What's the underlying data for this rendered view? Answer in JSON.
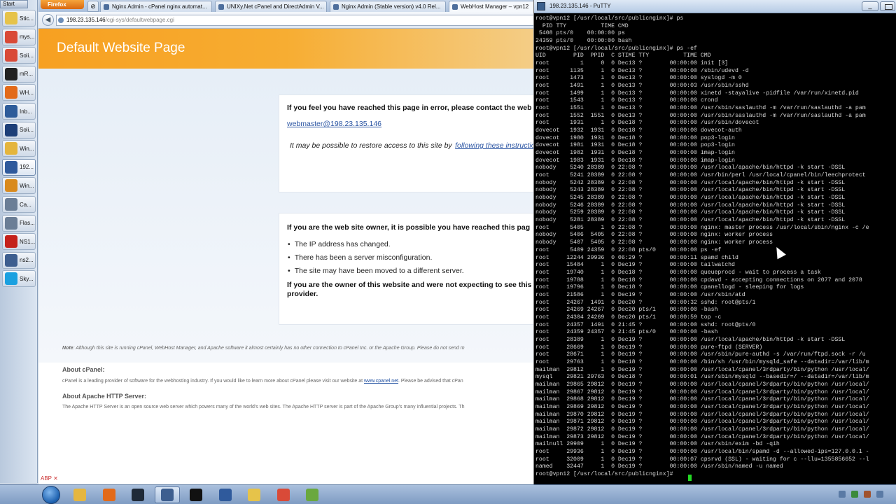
{
  "launcher": {
    "start_label": "Start",
    "items": [
      {
        "label": "Stic...",
        "icon": "sticky-notes-icon",
        "color": "#e6c34a"
      },
      {
        "label": "mys...",
        "icon": "chrome-icon",
        "color": "#d94a38"
      },
      {
        "label": "Soli...",
        "icon": "chrome-icon",
        "color": "#d94a38"
      },
      {
        "label": "mR...",
        "icon": "remote-icon",
        "color": "#222222"
      },
      {
        "label": "WH...",
        "icon": "firefox-icon",
        "color": "#e26a1a"
      },
      {
        "label": "Inb...",
        "icon": "thunderbird-icon",
        "color": "#2e5c9a"
      },
      {
        "label": "Soli...",
        "icon": "accessibility-icon",
        "color": "#1d3f78"
      },
      {
        "label": "Win...",
        "icon": "folder-icon",
        "color": "#e4b53d"
      },
      {
        "label": "192...",
        "icon": "network-icon",
        "color": "#2f5a9c"
      },
      {
        "label": "Win...",
        "icon": "media-icon",
        "color": "#d98a1d"
      },
      {
        "label": "Ca...",
        "icon": "window-icon",
        "color": "#6b7e96"
      },
      {
        "label": "Flas...",
        "icon": "window-icon",
        "color": "#6b7e96"
      },
      {
        "label": "NS1...",
        "icon": "filezilla-icon",
        "color": "#c4211b"
      },
      {
        "label": "ns2...",
        "icon": "putty-icon",
        "color": "#3d5e8f"
      },
      {
        "label": "Sky...",
        "icon": "skype-icon",
        "color": "#1aa0e0"
      }
    ]
  },
  "browser": {
    "menu_label": "Firefox",
    "tabs": [
      {
        "label": "Nginx Admin - cPanel nginx automat..."
      },
      {
        "label": "UNIXy.Net cPanel and DirectAdmin V..."
      },
      {
        "label": "Nginx Admin (Stable version) v4.0 Rel..."
      },
      {
        "label": "WebHost Manager – vpn12"
      }
    ],
    "url_host": "198.23.135.146",
    "url_path": "/cgi-sys/defaultwebpage.cgi",
    "page": {
      "title": "Default Website Page",
      "error_heading": "If you feel you have reached this page in error, please contact the web",
      "webmaster_email": "webmaster@198.23.135.146",
      "restore_text": "It may be possible to restore access to this site by",
      "restore_link": "following these instructio",
      "owner_heading": "If you are the web site owner, it is possible you have reached this pag",
      "reasons": [
        "The IP address has changed.",
        "There has been a server misconfiguration.",
        "The site may have been moved to a different server."
      ],
      "owner_not_expecting": "If you are the owner of this website and were not expecting to see this",
      "provider": "provider.",
      "note_label": "Note",
      "note_text": ": Although this site is running cPanel, WebHost Manager, and Apache software it almost certainly has no other connection to cPanel Inc. or the Apache Group. Please do not send m",
      "about_cpanel_heading": "About cPanel:",
      "about_cpanel_text": "cPanel is a leading provider of software for the webhosting industry. If you would like to learn more about cPanel please visit our website at",
      "about_cpanel_link": "www.cpanel.net",
      "about_cpanel_tail": ". Please be advised that cPan",
      "about_apache_heading": "About Apache HTTP Server:",
      "about_apache_text": "The Apache HTTP Server is an open source web server which powers many of the world's web sites. The Apache HTTP server is part of the Apache Group's many influential projects. Th"
    }
  },
  "putty": {
    "title": "198.23.135.146 - PuTTY",
    "lines": [
      "root@vpn12 [/usr/local/src/publicnginx]# ps",
      "  PID TTY          TIME CMD",
      " 5408 pts/0    00:00:00 ps",
      "24359 pts/0    00:00:00 bash",
      "root@vpn12 [/usr/local/src/publicnginx]# ps -ef",
      "UID        PID  PPID  C STIME TTY          TIME CMD",
      "root         1     0  0 Dec13 ?        00:00:00 init [3]",
      "root      1135     1  0 Dec13 ?        00:00:00 /sbin/udevd -d",
      "root      1473     1  0 Dec13 ?        00:00:00 syslogd -m 0",
      "root      1491     1  0 Dec13 ?        00:00:03 /usr/sbin/sshd",
      "root      1499     1  0 Dec13 ?        00:00:00 xinetd -stayalive -pidfile /var/run/xinetd.pid",
      "root      1543     1  0 Dec13 ?        00:00:00 crond",
      "root      1551     1  0 Dec13 ?        00:00:00 /usr/sbin/saslauthd -m /var/run/saslauthd -a pam",
      "root      1552  1551  0 Dec13 ?        00:00:00 /usr/sbin/saslauthd -m /var/run/saslauthd -a pam",
      "root      1931     1  0 Dec18 ?        00:00:00 /usr/sbin/dovecot",
      "dovecot   1932  1931  0 Dec18 ?        00:00:00 dovecot-auth",
      "dovecot   1980  1931  0 Dec18 ?        00:00:00 pop3-login",
      "dovecot   1981  1931  0 Dec18 ?        00:00:00 pop3-login",
      "dovecot   1982  1931  0 Dec18 ?        00:00:00 imap-login",
      "dovecot   1983  1931  0 Dec18 ?        00:00:00 imap-login",
      "nobody    5240 28389  0 22:08 ?        00:00:00 /usr/local/apache/bin/httpd -k start -DSSL",
      "root      5241 28389  0 22:08 ?        00:00:00 /usr/bin/perl /usr/local/cpanel/bin/leechprotect",
      "nobody    5242 28389  0 22:08 ?        00:00:00 /usr/local/apache/bin/httpd -k start -DSSL",
      "nobody    5243 28389  0 22:08 ?        00:00:00 /usr/local/apache/bin/httpd -k start -DSSL",
      "nobody    5245 28389  0 22:08 ?        00:00:00 /usr/local/apache/bin/httpd -k start -DSSL",
      "nobody    5246 28389  0 22:08 ?        00:00:00 /usr/local/apache/bin/httpd -k start -DSSL",
      "nobody    5259 28389  0 22:08 ?        00:00:00 /usr/local/apache/bin/httpd -k start -DSSL",
      "nobody    5281 28389  0 22:08 ?        00:00:00 /usr/local/apache/bin/httpd -k start -DSSL",
      "root      5405     1  0 22:08 ?        00:00:00 nginx: master process /usr/local/sbin/nginx -c /e",
      "nobody    5406  5405  0 22:08 ?        00:00:00 nginx: worker process",
      "nobody    5407  5405  0 22:08 ?        00:00:00 nginx: worker process",
      "root      5409 24359  0 22:08 pts/0    00:00:00 ps -ef",
      "root     12244 29936  0 06:29 ?        00:00:11 spamd child",
      "root     15484     1  0 Dec19 ?        00:00:00 tailwatchd",
      "root     19740     1  0 Dec18 ?        00:00:00 queueprocd - wait to process a task",
      "root     19788     1  0 Dec18 ?        00:00:00 cpdavd - accepting connections on 2077 and 2078",
      "root     19796     1  0 Dec18 ?        00:00:00 cpanellogd - sleeping for logs",
      "root     21586     1  0 Dec19 ?        00:00:00 /usr/sbin/atd",
      "root     24267  1491  0 Dec20 ?        00:00:32 sshd: root@pts/1",
      "root     24269 24267  0 Dec20 pts/1    00:00:00 -bash",
      "root     24304 24269  0 Dec20 pts/1    00:00:59 top -c",
      "root     24357  1491  0 21:45 ?        00:00:00 sshd: root@pts/0",
      "root     24359 24357  0 21:45 pts/0    00:00:00 -bash",
      "root     28389     1  0 Dec19 ?        00:00:00 /usr/local/apache/bin/httpd -k start -DSSL",
      "root     28669     1  0 Dec19 ?        00:00:00 pure-ftpd (SERVER)",
      "root     28671     1  0 Dec19 ?        00:00:00 /usr/sbin/pure-authd -s /var/run/ftpd.sock -r /u",
      "root     29763     1  0 Dec18 ?        00:00:00 /bin/sh /usr/bin/mysqld_safe --datadir=/var/lib/m",
      "mailman  29812     1  0 Dec19 ?        00:00:00 /usr/local/cpanel/3rdparty/bin/python /usr/local/",
      "mysql    29821 29763  0 Dec18 ?        00:00:01 /usr/sbin/mysqld --basedir=/ --datadir=/var/lib/m",
      "mailman  29865 29812  0 Dec19 ?        00:00:00 /usr/local/cpanel/3rdparty/bin/python /usr/local/",
      "mailman  29867 29812  0 Dec19 ?        00:00:00 /usr/local/cpanel/3rdparty/bin/python /usr/local/",
      "mailman  29868 29812  0 Dec19 ?        00:00:00 /usr/local/cpanel/3rdparty/bin/python /usr/local/",
      "mailman  29869 29812  0 Dec19 ?        00:00:00 /usr/local/cpanel/3rdparty/bin/python /usr/local/",
      "mailman  29870 29812  0 Dec19 ?        00:00:00 /usr/local/cpanel/3rdparty/bin/python /usr/local/",
      "mailman  29871 29812  0 Dec19 ?        00:00:00 /usr/local/cpanel/3rdparty/bin/python /usr/local/",
      "mailman  29872 29812  0 Dec19 ?        00:00:00 /usr/local/cpanel/3rdparty/bin/python /usr/local/",
      "mailman  29873 29812  0 Dec19 ?        00:00:00 /usr/local/cpanel/3rdparty/bin/python /usr/local/",
      "mailnull 29909     1  0 Dec19 ?        00:00:00 /usr/sbin/exim -bd -q1h",
      "root     29936     1  0 Dec19 ?        00:00:00 /usr/local/bin/spamd -d --allowed-ips=127.0.0.1 -",
      "root     32009     1  0 Dec19 ?        00:00:07 cpsrvd (SSL) - waiting for c --llu=1355856652 --l",
      "named    32447     1  0 Dec19 ?        00:00:00 /usr/sbin/named -u named",
      "root@vpn12 [/usr/local/src/publicnginx]# "
    ]
  },
  "taskbar": {
    "buttons": [
      {
        "icon": "explorer-icon",
        "color": "#e5b640",
        "active": false
      },
      {
        "icon": "firefox-icon",
        "color": "#e26a1a",
        "active": false
      },
      {
        "icon": "terminal-icon",
        "color": "#1f2a38",
        "active": false
      },
      {
        "icon": "putty-icon",
        "color": "#3d5e8f",
        "active": true
      },
      {
        "icon": "cmd-icon",
        "color": "#111111",
        "active": false
      },
      {
        "icon": "network-icon",
        "color": "#2f5a9c",
        "active": false
      },
      {
        "icon": "sticky-notes-icon",
        "color": "#e6c34a",
        "active": false
      },
      {
        "icon": "chrome-icon",
        "color": "#d94a38",
        "active": false
      },
      {
        "icon": "notepad-icon",
        "color": "#6aa83e",
        "active": false
      }
    ]
  }
}
